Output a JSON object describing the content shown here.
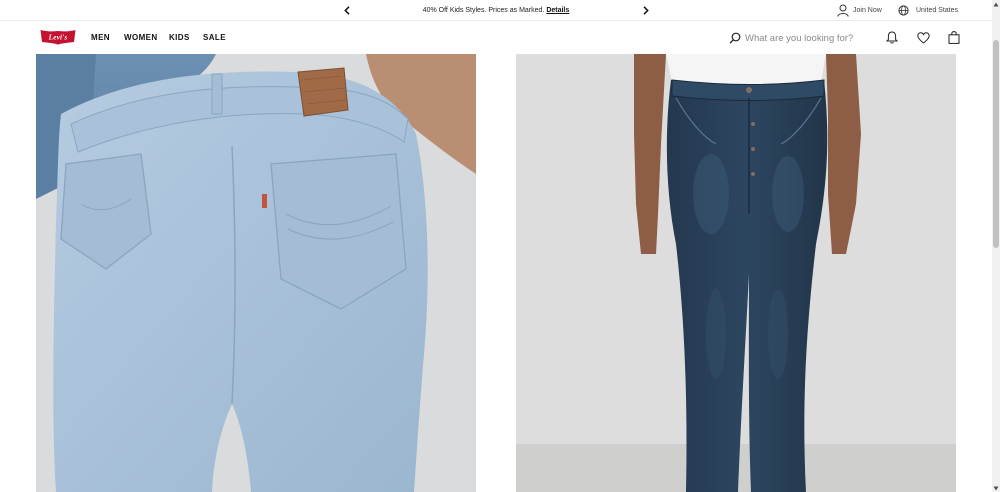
{
  "promo": {
    "text": "40% Off Kids Styles. Prices as Marked.",
    "link": "Details"
  },
  "utility": {
    "join_label": "Join Now",
    "country_label": "United States"
  },
  "brand": {
    "logo_alt": "Levi's",
    "color": "#c41230"
  },
  "nav": {
    "items": [
      {
        "label": "MEN"
      },
      {
        "label": "WOMEN"
      },
      {
        "label": "KIDS"
      },
      {
        "label": "SALE"
      }
    ]
  },
  "search": {
    "placeholder": "What are you looking for?"
  },
  "icons": {
    "prev": "chevron-left-icon",
    "next": "chevron-right-icon",
    "account": "user-icon",
    "country": "globe-icon",
    "search": "search-icon",
    "notifications": "bell-icon",
    "wishlist": "heart-icon",
    "bag": "shopping-bag-icon"
  },
  "hero": {
    "left_alt": "Light wash jeans back view",
    "right_alt": "Dark wash jeans front view"
  }
}
